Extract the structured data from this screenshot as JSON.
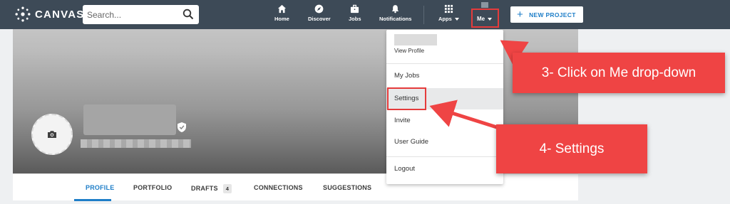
{
  "brand": {
    "name": "CANVAS"
  },
  "search": {
    "placeholder": "Search..."
  },
  "nav": {
    "home": "Home",
    "discover": "Discover",
    "jobs": "Jobs",
    "notifications": "Notifications",
    "apps": "Apps",
    "me": "Me"
  },
  "new_project": {
    "label": "NEW PROJECT"
  },
  "dropdown": {
    "view_profile": "View Profile",
    "items": [
      "My Jobs",
      "Settings",
      "Invite",
      "User Guide",
      "Logout"
    ]
  },
  "tabs": {
    "profile": "PROFILE",
    "portfolio": "PORTFOLIO",
    "drafts": "DRAFTS",
    "drafts_count": "4",
    "connections": "CONNECTIONS",
    "suggestions": "SUGGESTIONS"
  },
  "annotations": {
    "step3": "3- Click on Me drop-down",
    "step4": "4- Settings"
  },
  "colors": {
    "topbar": "#3d4a57",
    "accent": "#1e7ec8",
    "callout": "#ef4444"
  }
}
